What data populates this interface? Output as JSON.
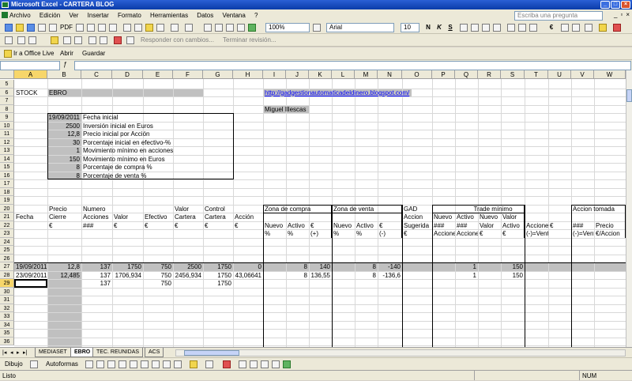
{
  "window": {
    "title": "Microsoft Excel - CARTERA BLOG"
  },
  "menu": {
    "items": [
      "Archivo",
      "Edición",
      "Ver",
      "Insertar",
      "Formato",
      "Herramientas",
      "Datos",
      "Ventana",
      "?"
    ],
    "ask_placeholder": "Escriba una pregunta"
  },
  "toolbar": {
    "pdf_label": "PDF",
    "zoom": "100%",
    "font": "Arial",
    "size": "10",
    "bold": "N",
    "italic": "K",
    "underline": "S",
    "euro": "€",
    "review_reply": "Responder con cambios...",
    "review_end": "Terminar revisión...",
    "office_live": "Ir a Office Live",
    "open": "Abrir",
    "save": "Guardar"
  },
  "columns": [
    "A",
    "B",
    "C",
    "D",
    "E",
    "F",
    "G",
    "H",
    "I",
    "J",
    "K",
    "L",
    "M",
    "N",
    "O",
    "P",
    "Q",
    "R",
    "S",
    "T",
    "U",
    "V",
    "W"
  ],
  "rows": [
    "5",
    "6",
    "7",
    "8",
    "9",
    "10",
    "11",
    "12",
    "13",
    "14",
    "15",
    "16",
    "17",
    "18",
    "19",
    "20",
    "21",
    "22",
    "23",
    "24",
    "25",
    "26",
    "27",
    "28",
    "29",
    "30",
    "31",
    "32",
    "33",
    "34",
    "35",
    "36"
  ],
  "sheet": {
    "stock_label": "STOCK",
    "stock_name": "EBRO",
    "blog_link": "http://gadgestionautomaticadeldinero.blogspot.com/",
    "author": "Miguel Illescas",
    "params": [
      {
        "value": "19/09/2011",
        "label": "Fecha inicial"
      },
      {
        "value": "2500",
        "label": "Inversión inicial en Euros"
      },
      {
        "value": "12,8",
        "label": "Precio inicial por Acción"
      },
      {
        "value": "30",
        "label": "Porcentaje inicial en efectivo-%"
      },
      {
        "value": "1",
        "label": "Movimiento mínimo en acciones"
      },
      {
        "value": "150",
        "label": "Movimiento mínimo en Euros"
      },
      {
        "value": "8",
        "label": "Porcentaje de compra %"
      },
      {
        "value": "8",
        "label": "Porcentaje de venta %"
      }
    ],
    "headers": {
      "r20": {
        "B": "Precio",
        "C": "Numero",
        "F": "Valor",
        "G": "Control",
        "I": "Zona de compra",
        "L": "Zona de venta",
        "O": "GAD",
        "Q": "Trade mínimo",
        "V": "Accion tomada"
      },
      "r21": {
        "A": "Fecha",
        "B": "Cierre",
        "C": "Acciones",
        "D": "Valor",
        "E": "Efectivo",
        "F": "Cartera",
        "G": "Cartera",
        "H": "Acción",
        "O": "Accion",
        "P": "Nuevo",
        "Q": "Activo",
        "R": "Nuevo",
        "S": "Valor"
      },
      "r22": {
        "B": "€",
        "C": "###",
        "D": "€",
        "E": "€",
        "F": "€",
        "G": "€",
        "H": "€",
        "I": "Nuevo",
        "J": "Activo",
        "K": "€",
        "L": "Nuevo",
        "M": "Activo",
        "N": "€",
        "O": "Sugerida",
        "P": "###",
        "Q": "###",
        "R": "Valor",
        "S": "Activo",
        "T": "Acciones",
        "U": "€",
        "V": "###",
        "W": "Precio"
      },
      "r23": {
        "I": "%",
        "J": "%",
        "K": "(+)",
        "L": "%",
        "M": "%",
        "N": "(-)",
        "O": "€",
        "P": "Acciones",
        "Q": "Acciones",
        "R": "€",
        "S": "€",
        "T": "(-)=Venta",
        "V": "(-)=Venta",
        "W": "€/Accion"
      }
    },
    "data_rows": [
      {
        "row": "27",
        "A": "19/09/2011",
        "B": "12,8",
        "C": "137",
        "D": "1750",
        "E": "750",
        "F": "2500",
        "G": "1750",
        "H": "0",
        "J": "8",
        "K": "140",
        "M": "8",
        "N": "-140",
        "Q": "1",
        "S": "150"
      },
      {
        "row": "28",
        "A": "23/09/2011",
        "B": "12,485",
        "C": "137",
        "D": "1706,934",
        "E": "750",
        "F": "2456,934",
        "G": "1750",
        "H": "43,06641",
        "J": "8",
        "K": "136,55",
        "M": "8",
        "N": "-136,6",
        "Q": "1",
        "S": "150"
      },
      {
        "row": "29",
        "C": "137",
        "E": "750",
        "G": "1750"
      }
    ]
  },
  "tabs": [
    "MEDIASET",
    "EBRO",
    "TEC. REUNIDAS",
    "ACS"
  ],
  "drawbar": {
    "draw": "Dibujo",
    "autoshapes": "Autoformas"
  },
  "status": {
    "left": "Listo",
    "num": "NUM"
  }
}
